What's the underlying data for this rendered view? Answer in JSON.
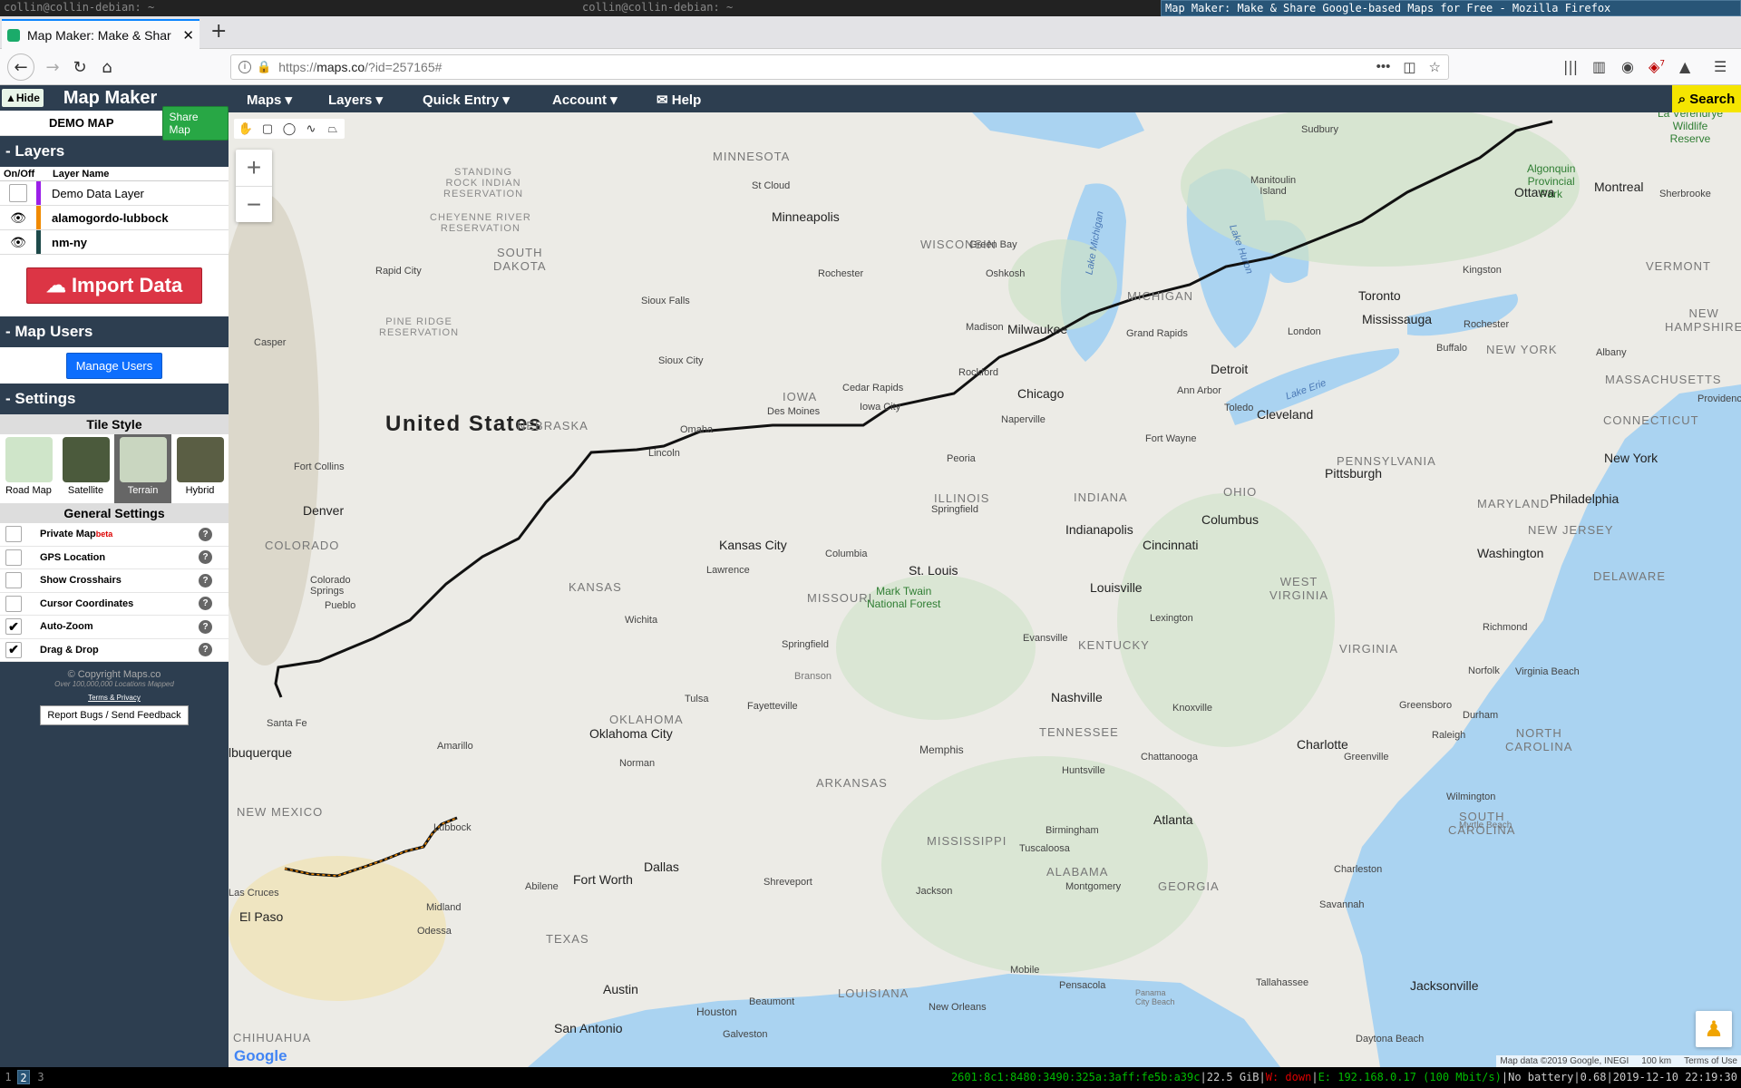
{
  "wm": {
    "left_title": "collin@collin-debian: ~",
    "mid_title": "collin@collin-debian: ~",
    "active_title": "Map Maker: Make & Share Google-based Maps for Free - Mozilla Firefox",
    "workspaces": [
      "1",
      "2",
      "3"
    ],
    "status": {
      "ipv6": "2601:8c1:8480:3490:325a:3aff:fe5b:a39c",
      "disk": "22.5 GiB",
      "wifi": "W: down",
      "eth": "E: 192.168.0.17 (100 Mbit/s)",
      "battery": "No battery",
      "load": "0.68",
      "time": "2019-12-10 22:19:30"
    }
  },
  "browser": {
    "tab_title": "Map Maker: Make & Shar",
    "url_scheme": "https://",
    "url_host": "maps.co",
    "url_path": "/?id=257165#",
    "badge": "7"
  },
  "app": {
    "hide_label": "▲Hide",
    "title": "Map Maker",
    "map_name": "DEMO MAP",
    "share_label": "Share Map",
    "layers_head": "- Layers",
    "col_onoff": "On/Off",
    "col_name": "Layer Name",
    "layers": [
      {
        "name": "Demo Data Layer",
        "color": "#9b1fe8",
        "visible": false
      },
      {
        "name": "alamogordo-lubbock",
        "color": "#f08a00",
        "visible": true
      },
      {
        "name": "nm-ny",
        "color": "#1e4a4a",
        "visible": true
      }
    ],
    "import_label": "Import Data",
    "users_head": "- Map Users",
    "manage_label": "Manage Users",
    "settings_head": "- Settings",
    "tile_style_head": "Tile Style",
    "tiles": [
      {
        "label": "Road Map",
        "color": "#cfe5c9"
      },
      {
        "label": "Satellite",
        "color": "#4b5a3c"
      },
      {
        "label": "Terrain",
        "color": "#c9d6c0"
      },
      {
        "label": "Hybrid",
        "color": "#5a5e44"
      }
    ],
    "active_tile": "Terrain",
    "general_head": "General Settings",
    "settings": [
      {
        "label": "Private Map",
        "beta": "beta",
        "checked": false
      },
      {
        "label": "GPS Location",
        "beta": "",
        "checked": false
      },
      {
        "label": "Show Crosshairs",
        "beta": "",
        "checked": false
      },
      {
        "label": "Cursor Coordinates",
        "beta": "",
        "checked": false
      },
      {
        "label": "Auto-Zoom",
        "beta": "",
        "checked": true
      },
      {
        "label": "Drag & Drop",
        "beta": "",
        "checked": true
      }
    ],
    "copyright": "© Copyright Maps.co",
    "copy_sub": "Over 100,000,000 Locations Mapped",
    "terms": "Terms & Privacy",
    "report": "Report Bugs / Send Feedback"
  },
  "menu": {
    "maps": "Maps ▾",
    "layers": "Layers ▾",
    "quick_entry": "Quick Entry ▾",
    "account": "Account ▾",
    "help": "✉ Help",
    "search": "⌕ Search"
  },
  "map": {
    "attribution": "Map data ©2019 Google, INEGI",
    "scale": "100 km",
    "terms": "Terms of Use",
    "google": "Google",
    "labels": {
      "us": "United States",
      "minnesota": "MINNESOTA",
      "wisconsin": "WISCONSIN",
      "michigan": "MICHIGAN",
      "iowa": "IOWA",
      "nebraska": "NEBRASKA",
      "southdakota": "SOUTH\nDAKOTA",
      "illinois": "ILLINOIS",
      "indiana": "INDIANA",
      "ohio": "OHIO",
      "pennsylvania": "PENNSYLVANIA",
      "newyork": "NEW YORK",
      "kansas": "KANSAS",
      "missouri": "MISSOURI",
      "kentucky": "KENTUCKY",
      "tennessee": "TENNESSEE",
      "oklahoma": "OKLAHOMA",
      "arkansas": "ARKANSAS",
      "mississippi": "MISSISSIPPI",
      "alabama": "ALABAMA",
      "georgia": "GEORGIA",
      "texas": "TEXAS",
      "louisiana": "LOUISIANA",
      "newmexico": "NEW MEXICO",
      "colorado": "COLORADO",
      "virginia": "VIRGINIA",
      "westvirginia": "WEST\nVIRGINIA",
      "northcarolina": "NORTH\nCAROLINA",
      "southcarolina": "SOUTH\nCAROLINA",
      "maryland": "MARYLAND",
      "newjersey": "NEW JERSEY",
      "delaware": "DELAWARE",
      "connecticut": "CONNECTICUT",
      "massachusetts": "MASSACHUSETTS",
      "vermont": "VERMONT",
      "newhampshire": "NEW\nHAMPSHIRE",
      "chihuahua": "CHIHUAHUA",
      "minneapolis": "Minneapolis",
      "chicago": "Chicago",
      "milwaukee": "Milwaukee",
      "detroit": "Detroit",
      "cleveland": "Cleveland",
      "toronto": "Toronto",
      "mississauga": "Mississauga",
      "ottawa": "Ottawa",
      "montreal": "Montreal",
      "newyorkcity": "New York",
      "philadelphia": "Philadelphia",
      "washington": "Washington",
      "pittsburgh": "Pittsburgh",
      "columbus": "Columbus",
      "indianapolis": "Indianapolis",
      "cincinnati": "Cincinnati",
      "louisville": "Louisville",
      "stlouis": "St. Louis",
      "kansascity": "Kansas City",
      "nashville": "Nashville",
      "memphis": "Memphis",
      "atlanta": "Atlanta",
      "charlotte": "Charlotte",
      "dallas": "Dallas",
      "fortworth": "Fort Worth",
      "austin": "Austin",
      "sanantonio": "San Antonio",
      "houston": "Houston",
      "oklahomacity": "Oklahoma City",
      "denver": "Denver",
      "elpaso": "El Paso",
      "jacksonville": "Jacksonville",
      "albuquerque": "lbuquerque",
      "lubbock": "Lubbock",
      "amarillo": "Amarillo",
      "wichita": "Wichita",
      "omaha": "Omaha",
      "desmoines": "Des Moines",
      "tulsa": "Tulsa",
      "springfield": "Springfield",
      "springfieldmo": "Springfield",
      "fortwayne": "Fort Wayne",
      "rochester": "Rochester",
      "buffalo": "Buffalo",
      "kingston": "Kingston",
      "london": "London",
      "madison": "Madison",
      "greenbay": "Green Bay",
      "siouxfalls": "Sioux Falls",
      "rapidcity": "Rapid City",
      "lincoln": "Lincoln",
      "santafe": "Santa Fe",
      "fortcollins": "Fort Collins",
      "coloradosprings": "Colorado\nSprings",
      "richmond": "Richmond",
      "raleigh": "Raleigh",
      "birmingham": "Birmingham",
      "jackson": "Jackson",
      "shreveport": "Shreveport",
      "neworleans": "New Orleans",
      "savannah": "Savannah",
      "montgomery": "Montgomery",
      "tallahassee": "Tallahassee",
      "greenville": "Greenville",
      "knoxville": "Knoxville",
      "lexington": "Lexington",
      "evansville": "Evansville",
      "peoria": "Peoria",
      "rockford": "Rockford",
      "cedarrapids": "Cedar Rapids",
      "norman": "Norman",
      "lawrence": "Lawrence",
      "fayetteville": "Fayetteville",
      "abilene": "Abilene",
      "midland": "Midland",
      "odessa": "Odessa",
      "lascruces": "Las Cruces",
      "pueblo": "Pueblo",
      "casper": "Casper",
      "siouxcity": "Sioux City",
      "stcloud": "St Cloud",
      "sudbury": "Sudbury",
      "sherbrooke": "Sherbrooke",
      "albany": "Albany",
      "providence": "Providence",
      "norfolk": "Norfolk",
      "virginiabeach": "Virginia Beach",
      "wilmington": "Wilmington",
      "charleston": "Charleston",
      "daytonabeach": "Daytona Beach",
      "mobile": "Mobile",
      "pensacola": "Pensacola",
      "beaumont": "Beaumont",
      "galveston": "Galveston",
      "toledo": "Toledo",
      "annarbor": "Ann Arbor",
      "grandrapids": "Grand Rapids",
      "naperville": "Naperville",
      "oshkosh": "Oshkosh",
      "iowacity": "Iowa City",
      "columbia": "Columbia",
      "huntsville": "Huntsville",
      "chattanooga": "Chattanooga",
      "durham": "Durham",
      "greensboro": "Greensboro",
      "tuscaloosa": "Tuscaloosa",
      "branson": "Branson",
      "marktwain": "Mark Twain\nNational Forest",
      "algonquin": "Algonquin\nProvincial\nPark",
      "laverendrye": "La Vérendrye\nWildlife\nReserve",
      "manitoulin": "Manitoulin\nIsland",
      "lakemichigan": "Lake Michigan",
      "lakehuron": "Lake Huron",
      "lakeerie": "Lake Erie",
      "standingrock": "STANDING\nROCK INDIAN\nRESERVATION",
      "cheyenneriver": "CHEYENNE RIVER\nRESERVATION",
      "pineridge": "PINE RIDGE\nRESERVATION",
      "myrtlebeach": "Myrtle Beach",
      "panamacity": "Panama\nCity Beach"
    }
  }
}
